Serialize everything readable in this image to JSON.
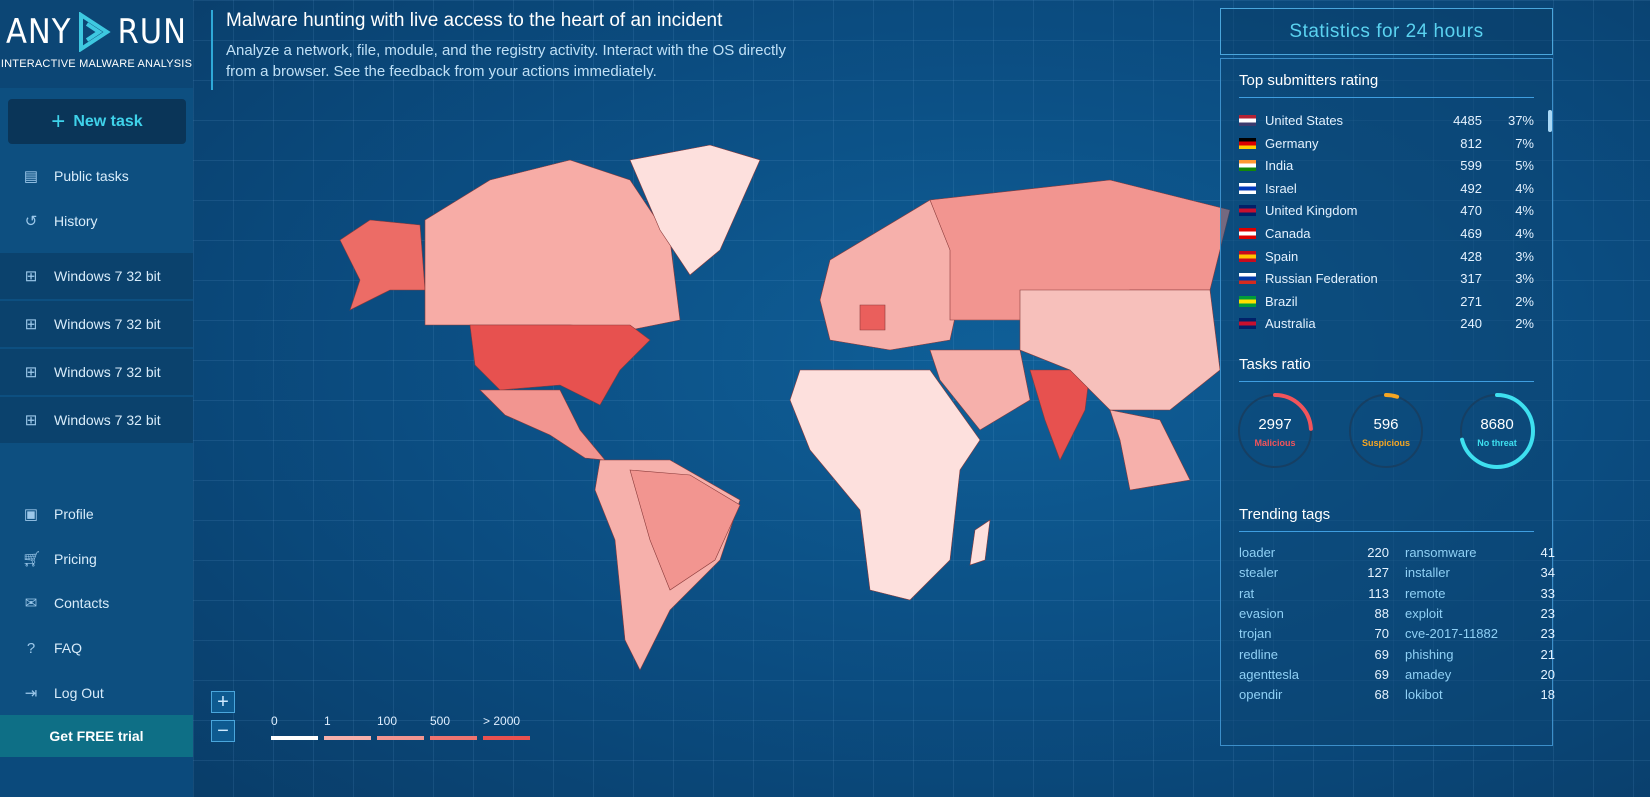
{
  "brand": {
    "name_left": "ANY",
    "name_right": "RUN",
    "tagline": "INTERACTIVE MALWARE ANALYSIS"
  },
  "sidebar": {
    "new_task": "New task",
    "items": [
      {
        "label": "Public tasks",
        "icon": "document-icon"
      },
      {
        "label": "History",
        "icon": "history-icon"
      }
    ],
    "environments": [
      "Windows 7 32 bit",
      "Windows 7 32 bit",
      "Windows 7 32 bit",
      "Windows 7 32 bit"
    ],
    "bottom": [
      {
        "label": "Profile",
        "icon": "profile-icon"
      },
      {
        "label": "Pricing",
        "icon": "cart-icon"
      },
      {
        "label": "Contacts",
        "icon": "mail-icon"
      },
      {
        "label": "FAQ",
        "icon": "help-icon"
      },
      {
        "label": "Log Out",
        "icon": "logout-icon"
      }
    ],
    "trial": "Get FREE trial"
  },
  "header": {
    "title": "Malware hunting with live access to the heart of an incident",
    "description": "Analyze a network, file, module, and the registry activity. Interact with the OS directly from a browser. See the feedback from your actions immediately."
  },
  "map": {
    "zoom_in": "+",
    "zoom_out": "−",
    "legend": [
      {
        "label": "0",
        "color": "#ffffff"
      },
      {
        "label": "1",
        "color": "#f6b0ab"
      },
      {
        "label": "100",
        "color": "#f29590"
      },
      {
        "label": "500",
        "color": "#ee7470"
      },
      {
        "label": "> 2000",
        "color": "#e9514f"
      }
    ]
  },
  "stats": {
    "title": "Statistics for 24 hours",
    "submitters_title": "Top submitters rating",
    "submitters": [
      {
        "country": "United States",
        "count": "4485",
        "pct": "37%"
      },
      {
        "country": "Germany",
        "count": "812",
        "pct": "7%"
      },
      {
        "country": "India",
        "count": "599",
        "pct": "5%"
      },
      {
        "country": "Israel",
        "count": "492",
        "pct": "4%"
      },
      {
        "country": "United Kingdom",
        "count": "470",
        "pct": "4%"
      },
      {
        "country": "Canada",
        "count": "469",
        "pct": "4%"
      },
      {
        "country": "Spain",
        "count": "428",
        "pct": "3%"
      },
      {
        "country": "Russian Federation",
        "count": "317",
        "pct": "3%"
      },
      {
        "country": "Brazil",
        "count": "271",
        "pct": "2%"
      },
      {
        "country": "Australia",
        "count": "240",
        "pct": "2%"
      }
    ],
    "ratio_title": "Tasks ratio",
    "ratio": [
      {
        "value": "2997",
        "label": "Malicious",
        "color": "#f2545b",
        "fraction": 0.24
      },
      {
        "value": "596",
        "label": "Suspicious",
        "color": "#f5a623",
        "fraction": 0.05
      },
      {
        "value": "8680",
        "label": "No threat",
        "color": "#3ee0f0",
        "fraction": 0.71
      }
    ],
    "tags_title": "Trending tags",
    "tags_left": [
      {
        "name": "loader",
        "count": "220"
      },
      {
        "name": "stealer",
        "count": "127"
      },
      {
        "name": "rat",
        "count": "113"
      },
      {
        "name": "evasion",
        "count": "88"
      },
      {
        "name": "trojan",
        "count": "70"
      },
      {
        "name": "redline",
        "count": "69"
      },
      {
        "name": "agenttesla",
        "count": "69"
      },
      {
        "name": "opendir",
        "count": "68"
      }
    ],
    "tags_right": [
      {
        "name": "ransomware",
        "count": "41"
      },
      {
        "name": "installer",
        "count": "34"
      },
      {
        "name": "remote",
        "count": "33"
      },
      {
        "name": "exploit",
        "count": "23"
      },
      {
        "name": "cve-2017-11882",
        "count": "23"
      },
      {
        "name": "phishing",
        "count": "21"
      },
      {
        "name": "amadey",
        "count": "20"
      },
      {
        "name": "lokibot",
        "count": "18"
      }
    ]
  }
}
